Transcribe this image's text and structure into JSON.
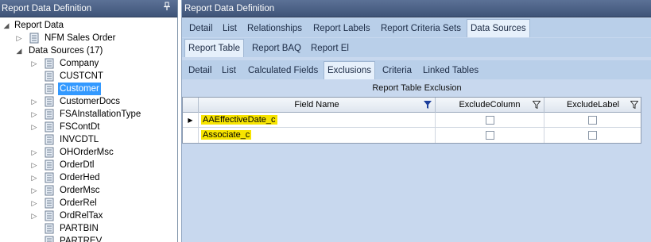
{
  "left_panel": {
    "title": "Report Data Definition",
    "pin": "❘",
    "tree": {
      "root": "Report Data",
      "nfm": "NFM Sales Order",
      "data_sources": "Data Sources (17)",
      "items": [
        {
          "label": "Company",
          "expandable": true
        },
        {
          "label": "CUSTCNT",
          "expandable": false
        },
        {
          "label": "Customer",
          "expandable": false,
          "selected": true
        },
        {
          "label": "CustomerDocs",
          "expandable": true
        },
        {
          "label": "FSAInstallationType",
          "expandable": true
        },
        {
          "label": "FSContDt",
          "expandable": true
        },
        {
          "label": "INVCDTL",
          "expandable": false
        },
        {
          "label": "OHOrderMsc",
          "expandable": true
        },
        {
          "label": "OrderDtl",
          "expandable": true
        },
        {
          "label": "OrderHed",
          "expandable": true
        },
        {
          "label": "OrderMsc",
          "expandable": true
        },
        {
          "label": "OrderRel",
          "expandable": true
        },
        {
          "label": "OrdRelTax",
          "expandable": true
        },
        {
          "label": "PARTBIN",
          "expandable": false
        },
        {
          "label": "PARTREV",
          "expandable": false
        }
      ]
    }
  },
  "right_panel": {
    "title": "Report Data Definition",
    "tabs_l1": [
      "Detail",
      "List",
      "Relationships",
      "Report Labels",
      "Report Criteria Sets",
      "Data Sources"
    ],
    "tabs_l2": [
      "Report Table",
      "Report BAQ",
      "Report El"
    ],
    "tabs_l3": [
      "Detail",
      "List",
      "Calculated Fields",
      "Exclusions",
      "Criteria",
      "Linked Tables"
    ],
    "grid_title": "Report Table Exclusion",
    "columns": [
      "Field Name",
      "ExcludeColumn",
      "ExcludeLabel"
    ],
    "rows": [
      {
        "field": "AAEffectiveDate_c",
        "exclude_column": false,
        "exclude_label": false,
        "current": true
      },
      {
        "field": "Associate_c",
        "exclude_column": false,
        "exclude_label": false,
        "current": false
      }
    ],
    "row_marker": "▶"
  },
  "colors": {
    "header_bg": "#4a5f84",
    "panel_bg": "#c8d8ee",
    "selected": "#3399ff",
    "highlight": "#f7e400"
  }
}
